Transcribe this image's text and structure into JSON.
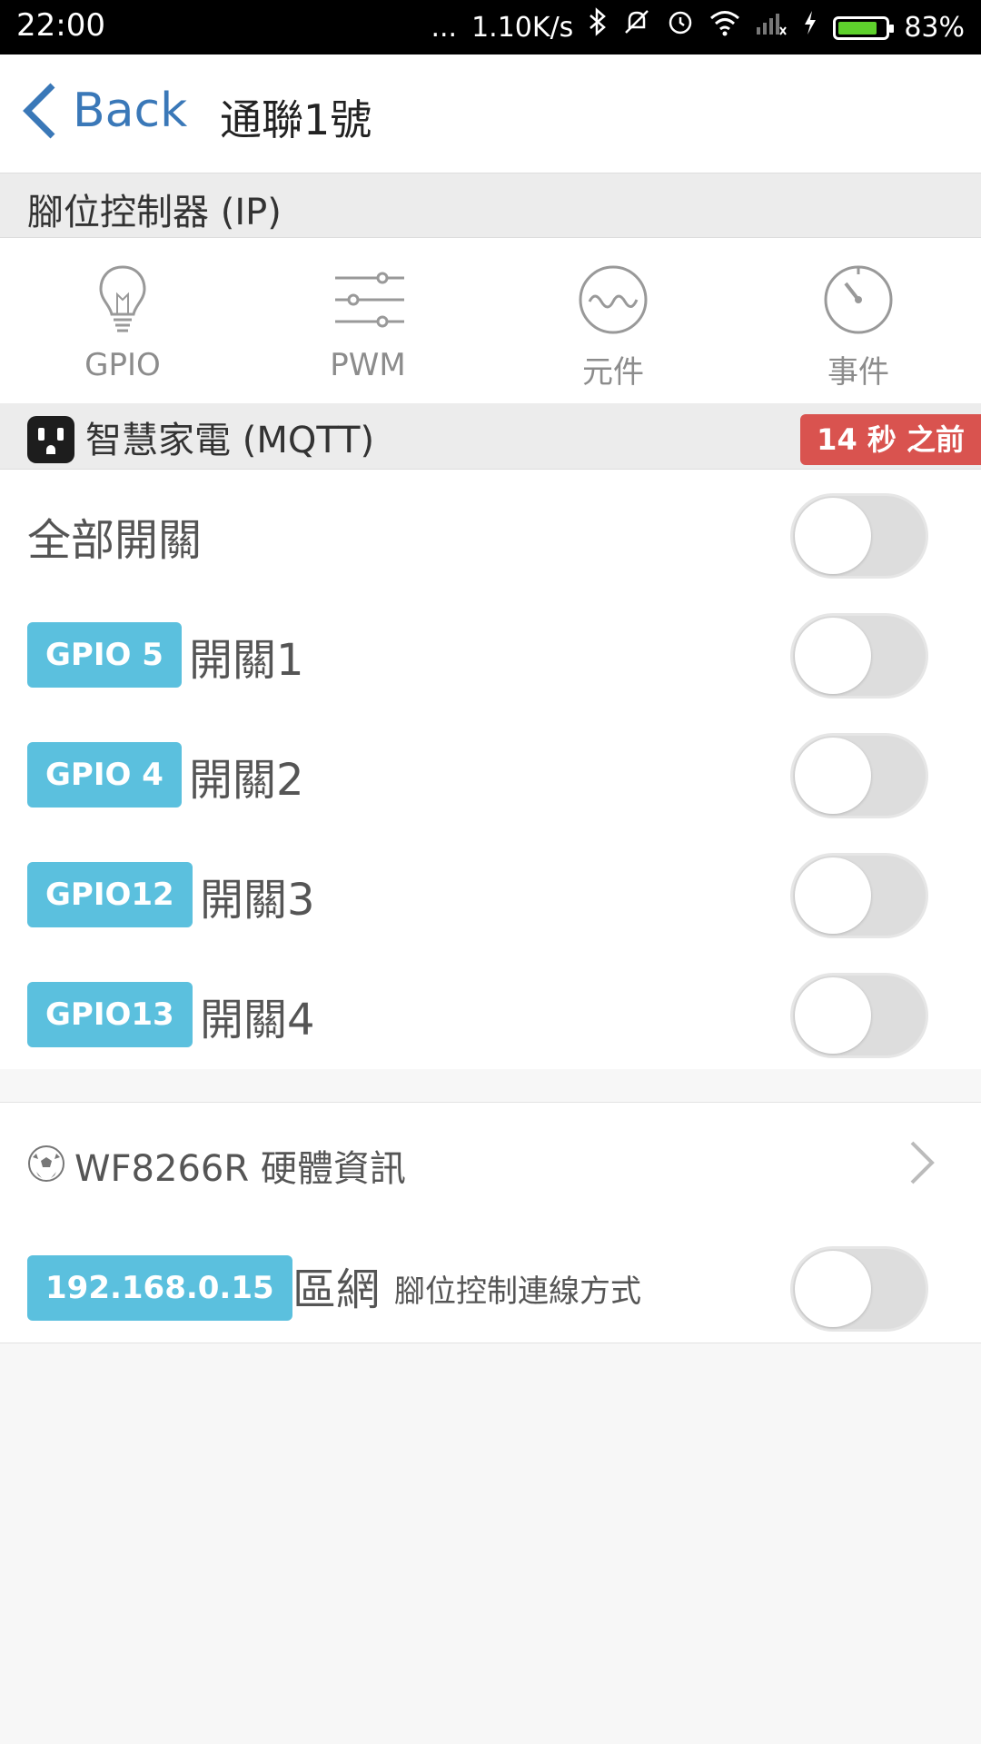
{
  "status": {
    "time": "22:00",
    "dots": "...",
    "speed": "1.10K/s",
    "battery_pct": "83%",
    "battery_level": 0.83,
    "battery_color": "#5ed12c",
    "icons": [
      "bluetooth-icon",
      "mute-icon",
      "alarm-icon",
      "wifi-icon",
      "signal-icon",
      "charging-icon",
      "battery-icon"
    ]
  },
  "nav": {
    "back_label": "Back",
    "title": "通聯1號"
  },
  "ip_section": {
    "label": "腳位控制器 (IP)"
  },
  "tools": [
    {
      "label": "GPIO",
      "icon": "lightbulb-icon"
    },
    {
      "label": "PWM",
      "icon": "sliders-icon"
    },
    {
      "label": "元件",
      "icon": "wave-icon"
    },
    {
      "label": "事件",
      "icon": "timer-icon"
    }
  ],
  "mqtt_section": {
    "label": "智慧家電 (MQTT)",
    "time_badge": "14 秒 之前",
    "badge_color": "#d9534f"
  },
  "master": {
    "label": "全部開關",
    "on": false
  },
  "switches": [
    {
      "gpio": "GPIO 5",
      "label": "開關1",
      "on": false
    },
    {
      "gpio": "GPIO 4",
      "label": "開關2",
      "on": false
    },
    {
      "gpio": "GPIO12",
      "label": "開關3",
      "on": false
    },
    {
      "gpio": "GPIO13",
      "label": "開關4",
      "on": false
    }
  ],
  "hardware": {
    "label": "WF8266R 硬體資訊"
  },
  "network": {
    "ip": "192.168.0.15",
    "mode": "區網",
    "desc": "腳位控制連線方式",
    "on": false
  },
  "colors": {
    "accent": "#3a78b8",
    "gpio_badge": "#5bc0de"
  }
}
